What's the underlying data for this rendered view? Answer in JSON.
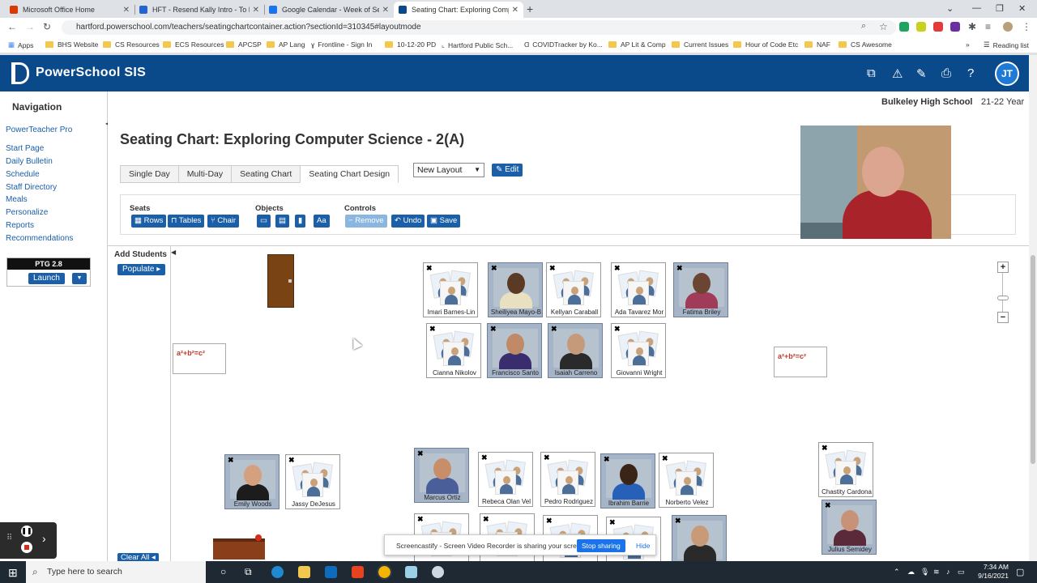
{
  "browser": {
    "tabs": [
      {
        "title": "Microsoft Office Home",
        "icon_color": "#d83b01"
      },
      {
        "title": "HFT - Resend Kally Intro - To Do",
        "icon_color": "#2564cf"
      },
      {
        "title": "Google Calendar - Week of Septe",
        "icon_color": "#1a73e8"
      },
      {
        "title": "Seating Chart: Exploring Comput",
        "icon_color": "#0a4a8a"
      }
    ],
    "url": "hartford.powerschool.com/teachers/seatingchartcontainer.action?sectionId=310345#layoutmode",
    "bookmarks": [
      "Apps",
      "BHS Website",
      "CS Resources",
      "ECS Resources",
      "APCSP",
      "AP Lang",
      "Frontline - Sign In",
      "10-12-20 PD",
      "Hartford Public Sch...",
      "COVIDTracker by Ko...",
      "AP Lit & Comp",
      "Current Issues",
      "Hour of Code Etc",
      "NAF",
      "CS Awesome"
    ],
    "reading_list": "Reading list"
  },
  "header": {
    "app_title": "PowerSchool SIS",
    "avatar_initials": "JT"
  },
  "nav": {
    "title": "Navigation",
    "items": [
      "PowerTeacher Pro",
      "Start Page",
      "Daily Bulletin",
      "Schedule",
      "Staff Directory",
      "Meals",
      "Personalize",
      "Reports",
      "Recommendations"
    ],
    "ptg_label": "PTG 2.8",
    "launch_label": "Launch"
  },
  "page": {
    "school": "Bulkeley High School",
    "year": "21-22 Year",
    "title": "Seating Chart: Exploring Computer Science - 2(A)",
    "tabs": [
      "Single Day",
      "Multi-Day",
      "Seating Chart",
      "Seating Chart Design"
    ],
    "layout_select": "New Layout",
    "edit_label": "Edit"
  },
  "toolbox": {
    "seats_label": "Seats",
    "objects_label": "Objects",
    "controls_label": "Controls",
    "rows": "Rows",
    "tables": "Tables",
    "chair": "Chair",
    "text_obj": "Aa",
    "remove": "Remove",
    "undo": "Undo",
    "save": "Save"
  },
  "chart": {
    "add_students": "Add Students",
    "populate": "Populate",
    "clear_all": "Clear All",
    "board_text": "a²+b²=c²",
    "students": [
      {
        "name": "Imari Barnes-Lin",
        "photo": false
      },
      {
        "name": "Sheiliyea Mayo-B",
        "photo": true,
        "skin": "#5a3a25",
        "clothes": "#e8e0c0"
      },
      {
        "name": "Kellyan Caraball",
        "photo": false
      },
      {
        "name": "Ada Tavarez Mor",
        "photo": false
      },
      {
        "name": "Fatima Briley",
        "photo": true,
        "skin": "#6b4532",
        "clothes": "#a03c5a"
      },
      {
        "name": "Cianna Nikolov",
        "photo": false
      },
      {
        "name": "Francisco Santo",
        "photo": true,
        "skin": "#c08a66",
        "clothes": "#3a2d6e"
      },
      {
        "name": "Isaiah Carreno",
        "photo": true,
        "skin": "#c49a7a",
        "clothes": "#2a2a2a"
      },
      {
        "name": "Giovanni Wright",
        "photo": false
      },
      {
        "name": "Emily Woods",
        "photo": true,
        "skin": "#d4a07e",
        "clothes": "#1c1c1c"
      },
      {
        "name": "Jassy DeJesus",
        "photo": false
      },
      {
        "name": "Marcus Ortiz",
        "photo": true,
        "skin": "#c88e6a",
        "clothes": "#4a5e9a"
      },
      {
        "name": "Rebeca Olan Vel",
        "photo": false
      },
      {
        "name": "Pedro Rodriguez",
        "photo": false
      },
      {
        "name": "Ibrahim Barrie",
        "photo": true,
        "skin": "#3a2418",
        "clothes": "#2760b8"
      },
      {
        "name": "Norberto Velez",
        "photo": false
      },
      {
        "name": "Chastity Cardona",
        "photo": false
      },
      {
        "name": "Julius Semidey",
        "photo": true,
        "skin": "#c89278",
        "clothes": "#5a2a3a"
      },
      {
        "name": "",
        "photo": false
      },
      {
        "name": "",
        "photo": false
      },
      {
        "name": "",
        "photo": false
      },
      {
        "name": "",
        "photo": false
      },
      {
        "name": "",
        "photo": true,
        "skin": "#c99a78",
        "clothes": "#2a2a2a"
      }
    ]
  },
  "sharing": {
    "text": "Screencastify - Screen Video Recorder is sharing your screen.",
    "stop": "Stop sharing",
    "hide": "Hide"
  },
  "taskbar": {
    "search_placeholder": "Type here to search",
    "time": "7:34 AM",
    "date": "9/16/2021"
  }
}
